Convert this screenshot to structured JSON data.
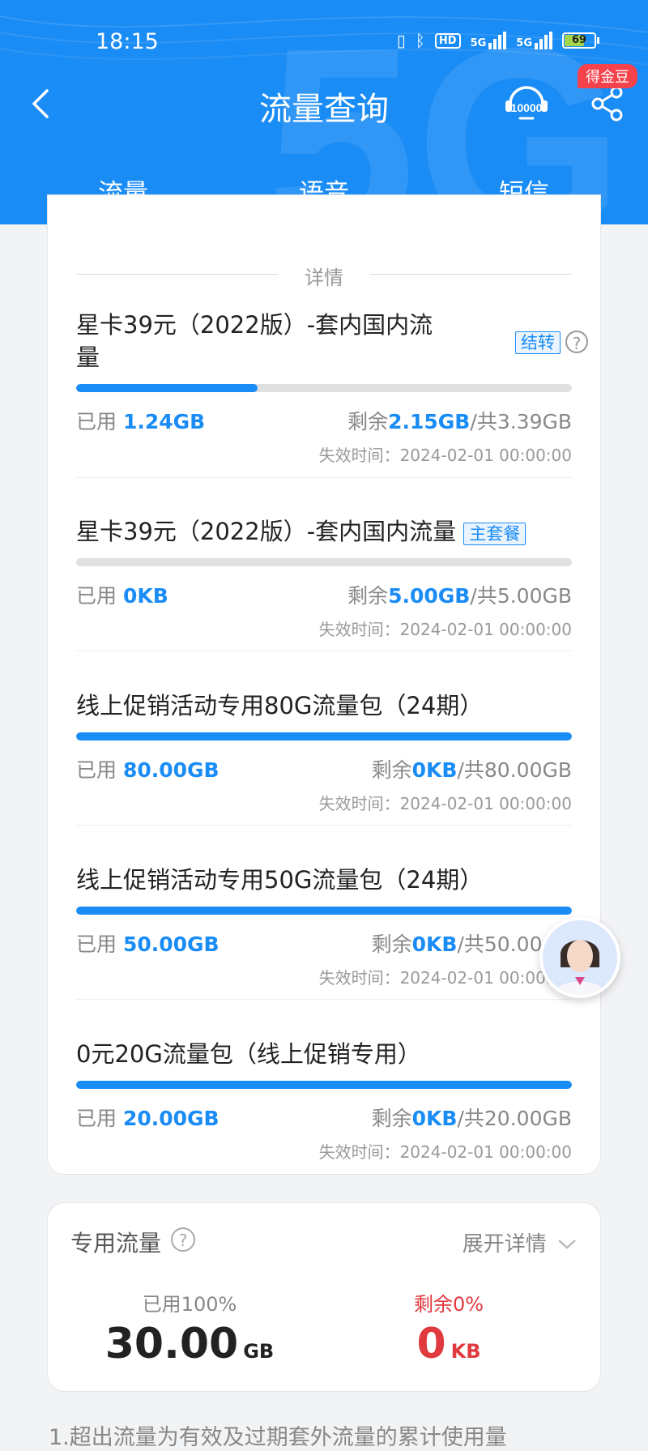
{
  "status_bar": {
    "time": "18:15",
    "hd": "HD",
    "net1": "5G",
    "net2": "5G",
    "battery": "69",
    "battery_level": 0.69
  },
  "nav": {
    "title": "流量查询",
    "badge": "得金豆",
    "service_number": "10000"
  },
  "tabs": [
    {
      "label": "流量"
    },
    {
      "label": "语音"
    },
    {
      "label": "短信"
    }
  ],
  "detail_header": "详情",
  "common": {
    "used_label": "已用 ",
    "remain_label": "剩余",
    "total_sep": "/共"
  },
  "items": [
    {
      "title": "星卡39元（2022版）-套内国内流量",
      "tag": "结转",
      "used": "1.24GB",
      "remaining": "2.15GB",
      "total": "3.39GB",
      "used_fraction": 0.366,
      "expire": "失效时间：2024-02-01 00:00:00"
    },
    {
      "title": "星卡39元（2022版）-套内国内流量",
      "tag": "主套餐",
      "used": "0KB",
      "remaining": "5.00GB",
      "total": "5.00GB",
      "used_fraction": 0,
      "expire": "失效时间：2024-02-01 00:00:00"
    },
    {
      "title": "线上促销活动专用80G流量包（24期）",
      "used": "80.00GB",
      "remaining": "0KB",
      "total": "80.00GB",
      "used_fraction": 1,
      "expire": "失效时间：2024-02-01 00:00:00"
    },
    {
      "title": "线上促销活动专用50G流量包（24期）",
      "used": "50.00GB",
      "remaining": "0KB",
      "total": "50.00GB",
      "used_fraction": 1,
      "expire": "失效时间：2024-02-01 00:00:00"
    },
    {
      "title": "0元20G流量包（线上促销专用）",
      "used": "20.00GB",
      "remaining": "0KB",
      "total": "20.00GB",
      "used_fraction": 1,
      "expire": "失效时间：2024-02-01 00:00:00"
    }
  ],
  "special": {
    "title": "专用流量",
    "expand": "展开详情",
    "used_label": "已用100%",
    "used_value": "30.00",
    "used_unit": "GB",
    "remain_label": "剩余0%",
    "remain_value": "0",
    "remain_unit": "KB"
  },
  "footnote": "1.超出流量为有效及过期套外流量的累计使用量",
  "colors": {
    "primary": "#1a8cf5",
    "danger": "#e0393e",
    "badge": "#f5424b"
  }
}
